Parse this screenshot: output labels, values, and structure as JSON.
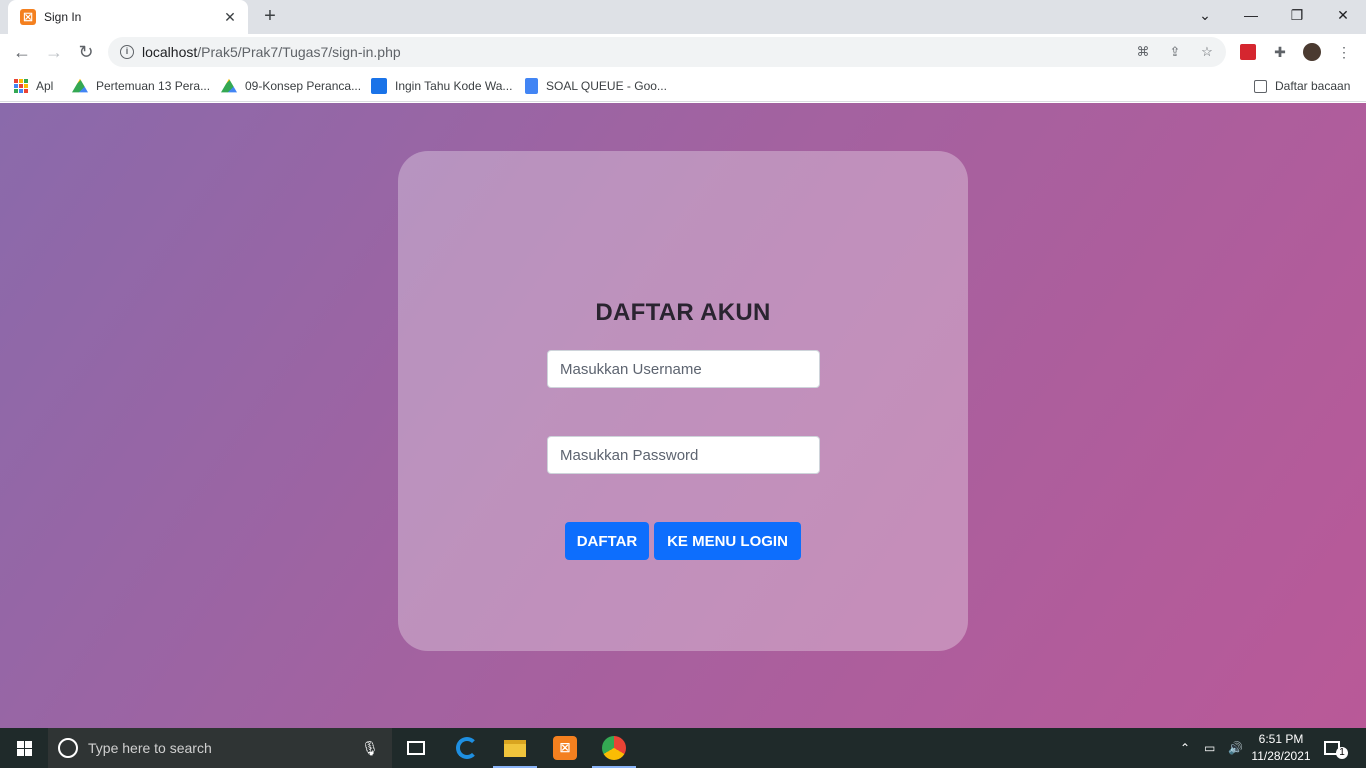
{
  "browser": {
    "tab_title": "Sign In",
    "tab_favicon": "xampp-icon",
    "url_host": "localhost",
    "url_path": "/Prak5/Prak7/Tugas7/sign-in.php"
  },
  "bookmarks": {
    "apps_label": "Apl",
    "items": [
      "Pertemuan 13 Pera...",
      "09-Konsep Peranca...",
      "Ingin Tahu Kode Wa...",
      "SOAL QUEUE - Goo..."
    ],
    "reading_list": "Daftar bacaan"
  },
  "form": {
    "title": "DAFTAR AKUN",
    "username_placeholder": "Masukkan Username",
    "password_placeholder": "Masukkan Password",
    "register_label": "DAFTAR",
    "login_menu_label": "KE MENU LOGIN"
  },
  "taskbar": {
    "search_placeholder": "Type here to search",
    "time": "6:51 PM",
    "date": "11/28/2021",
    "notification_count": "1"
  },
  "colors": {
    "accent_button": "#0d6efd",
    "gradient_start": "#8a6aab",
    "gradient_end": "#b95998"
  }
}
